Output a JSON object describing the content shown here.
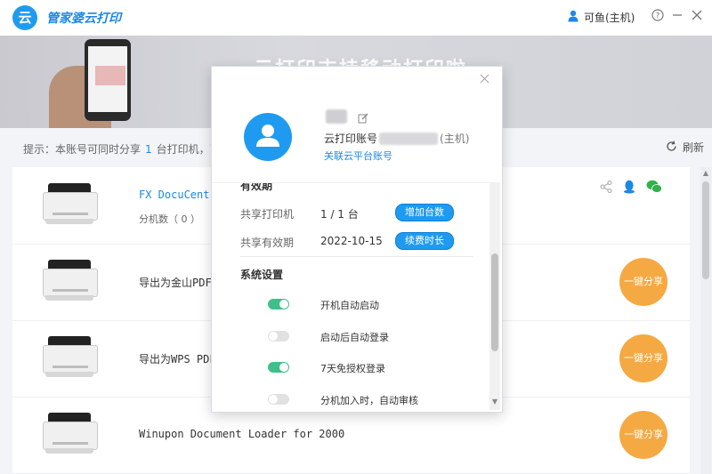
{
  "titlebar": {
    "logo_text": "云",
    "app_title": "管家婆云打印",
    "user_label": "可鱼(主机)",
    "help_icon": "help-circle-icon",
    "minimize_icon": "minimize-icon",
    "close_icon": "close-icon"
  },
  "banner": {
    "headline": "云打印支持移动打印啦"
  },
  "tipbar": {
    "tip_prefix": "提示：本账号可同时分享",
    "tip_count": "1",
    "tip_suffix": "台打印机，已分享",
    "refresh_label": "刷新"
  },
  "printers": [
    {
      "name": "FX DocuCentr",
      "subcount_label": "分机数（ 0 ）"
    },
    {
      "name": "导出为金山PDF",
      "share_label": "一键分享"
    },
    {
      "name": "导出为WPS PDF",
      "share_label": "一键分享"
    },
    {
      "name": "Winupon Document Loader for 2000",
      "share_label": "一键分享"
    }
  ],
  "modal": {
    "account_prefix": "云打印账号",
    "account_suffix": "(主机)",
    "link_label": "关联云平台账号",
    "validity_section": "有效期",
    "shared_printer_label": "共享打印机",
    "shared_printer_value": "1 / 1 台",
    "add_button": "增加台数",
    "share_validity_label": "共享有效期",
    "share_validity_value": "2022-10-15",
    "renew_button": "续费时长",
    "settings_section": "系统设置",
    "settings": [
      {
        "label": "开机自动启动",
        "on": true
      },
      {
        "label": "启动后自动登录",
        "on": false
      },
      {
        "label": "7天免授权登录",
        "on": true
      },
      {
        "label": "分机加入时，自动审核",
        "on": false
      }
    ]
  },
  "colors": {
    "brand": "#1e9bf0",
    "share_button": "#f5a942",
    "toggle_on": "#3ec08a"
  }
}
